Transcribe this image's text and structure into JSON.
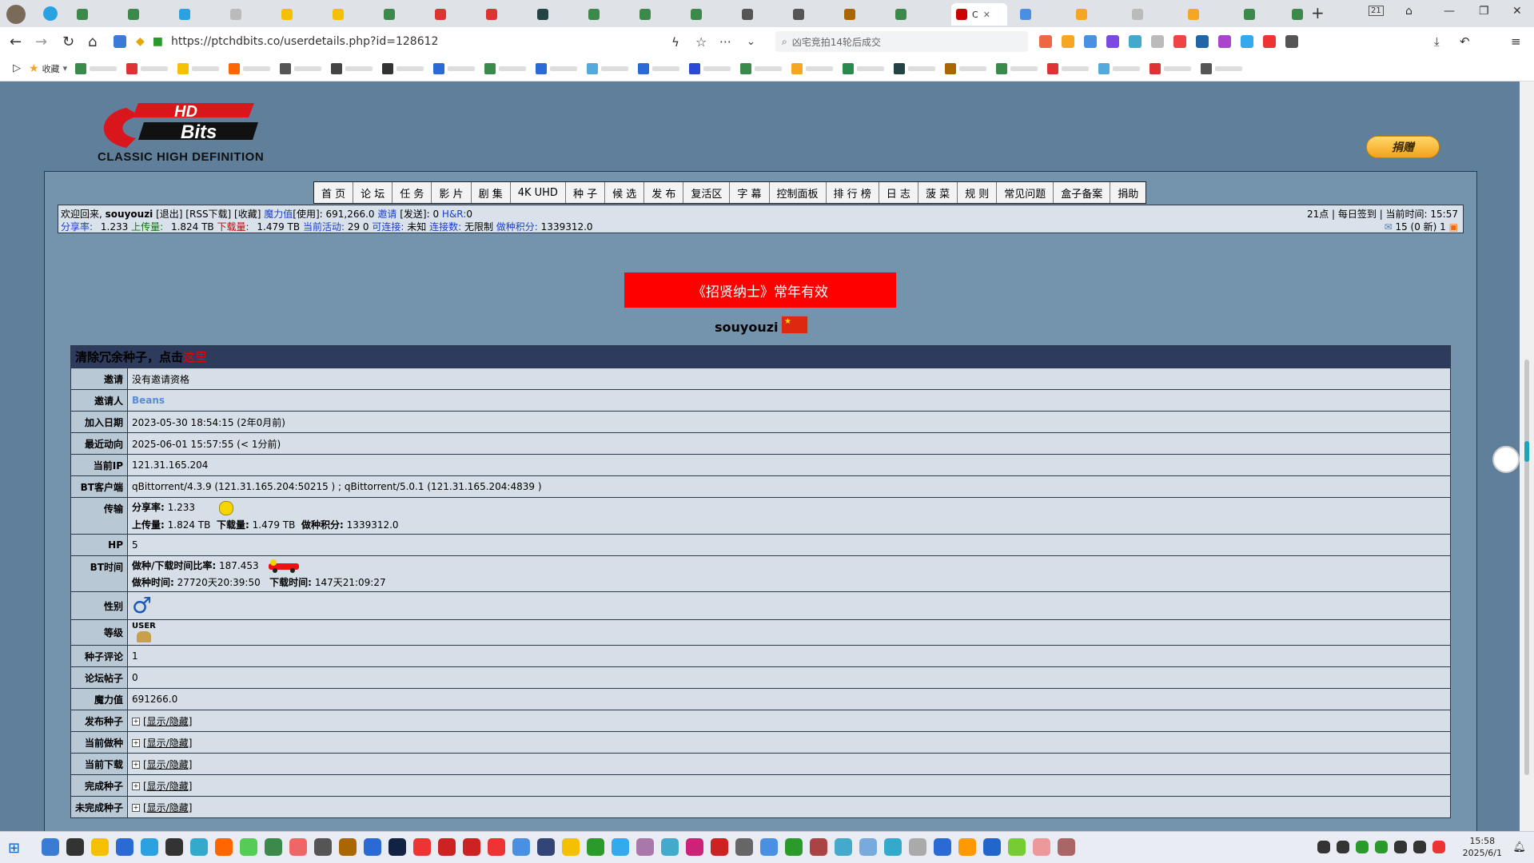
{
  "browser": {
    "active_tab_label": "C",
    "tab_count_badge": "21",
    "url": "https://ptchdbits.co/userdetails.php?id=128612",
    "search_placeholder": "凶宅竞拍14轮后成交",
    "bookmark_folder": "收藏"
  },
  "site": {
    "logo_text": "HD Bits",
    "logo_subtitle": "CLASSIC HIGH DEFINITION",
    "donate_label": "捐赠"
  },
  "menu": [
    "首 页",
    "论 坛",
    "任 务",
    "影 片",
    "剧 集",
    "4K UHD",
    "种 子",
    "候 选",
    "发 布",
    "复活区",
    "字 幕",
    "控制面板",
    "排 行 榜",
    "日 志",
    "菠 菜",
    "规 则",
    "常见问题",
    "盒子备案",
    "捐助"
  ],
  "infobar": {
    "welcome": "欢迎回来,",
    "username": "souyouzi",
    "links": "[退出] [RSS下载] [收藏]",
    "bonus_label": "魔力值",
    "bonus_value": "[使用]: 691,266.0",
    "invite_label": "邀请",
    "invite_value": "[发送]: 0",
    "hr_label": "H&R:",
    "hr_value": "0",
    "ratio_label": "分享率:",
    "ratio_value": "1.233",
    "upload_label": "上传量:",
    "upload_value": "1.824 TB",
    "download_label": "下载量:",
    "download_value": "1.479 TB",
    "active_label": "当前活动:",
    "active_value": "29 0",
    "connectable_label": "可连接:",
    "connectable_value": "未知",
    "connections_label": "连接数:",
    "connections_value": "无限制",
    "seed_points_label": "做种积分:",
    "seed_points_value": "1339312.0",
    "right_top": "21点 | 每日签到 | 当前时间: 15:57",
    "right_bottom": "15 (0 新)  1"
  },
  "banner": "《招贤纳士》常年有效",
  "profile_name": "souyouzi",
  "table": {
    "header_text": "清除冗余种子，点击",
    "header_link": "这里",
    "rows": [
      {
        "k": "邀请",
        "v": "没有邀请资格"
      },
      {
        "k": "邀请人",
        "v": "Beans"
      },
      {
        "k": "加入日期",
        "v": "2023-05-30 18:54:15 (2年0月前)"
      },
      {
        "k": "最近动向",
        "v": "2025-06-01 15:57:55 (< 1分前)"
      },
      {
        "k": "当前IP",
        "v": "121.31.165.204"
      },
      {
        "k": "BT客户端",
        "v": "qBittorrent/4.3.9 (121.31.165.204:50215 ) ; qBittorrent/5.0.1 (121.31.165.204:4839 )"
      }
    ],
    "transfer": {
      "k": "传输",
      "ratio_label": "分享率:",
      "ratio": "1.233",
      "up_label": "上传量:",
      "up": "1.824 TB",
      "down_label": "下载量:",
      "down": "1.479 TB",
      "seed_label": "做种积分:",
      "seed": "1339312.0"
    },
    "hp": {
      "k": "HP",
      "v": "5"
    },
    "bt_time": {
      "k": "BT时间",
      "ratio_label": "做种/下载时间比率:",
      "ratio": "187.453",
      "seed_label": "做种时间:",
      "seed": "27720天20:39:50",
      "dl_label": "下载时间:",
      "dl": "147天21:09:27"
    },
    "gender": {
      "k": "性别",
      "symbol": "♂"
    },
    "level": {
      "k": "等级",
      "v": "USER"
    },
    "rows2": [
      {
        "k": "种子评论",
        "v": "1"
      },
      {
        "k": "论坛帖子",
        "v": "0"
      },
      {
        "k": "魔力值",
        "v": "691266.0"
      }
    ],
    "toggles": [
      {
        "k": "发布种子",
        "v": "[显示/隐藏]"
      },
      {
        "k": "当前做种",
        "v": "[显示/隐藏]"
      },
      {
        "k": "当前下载",
        "v": "[显示/隐藏]"
      },
      {
        "k": "完成种子",
        "v": "[显示/隐藏]"
      },
      {
        "k": "未完成种子",
        "v": "[显示/隐藏]"
      }
    ]
  },
  "taskbar": {
    "time": "15:58",
    "date": "2025/6/1"
  },
  "colors": {
    "page_bg": "#5f7f9b",
    "banner": "#ff0000",
    "table_head": "#2d3c5c"
  }
}
